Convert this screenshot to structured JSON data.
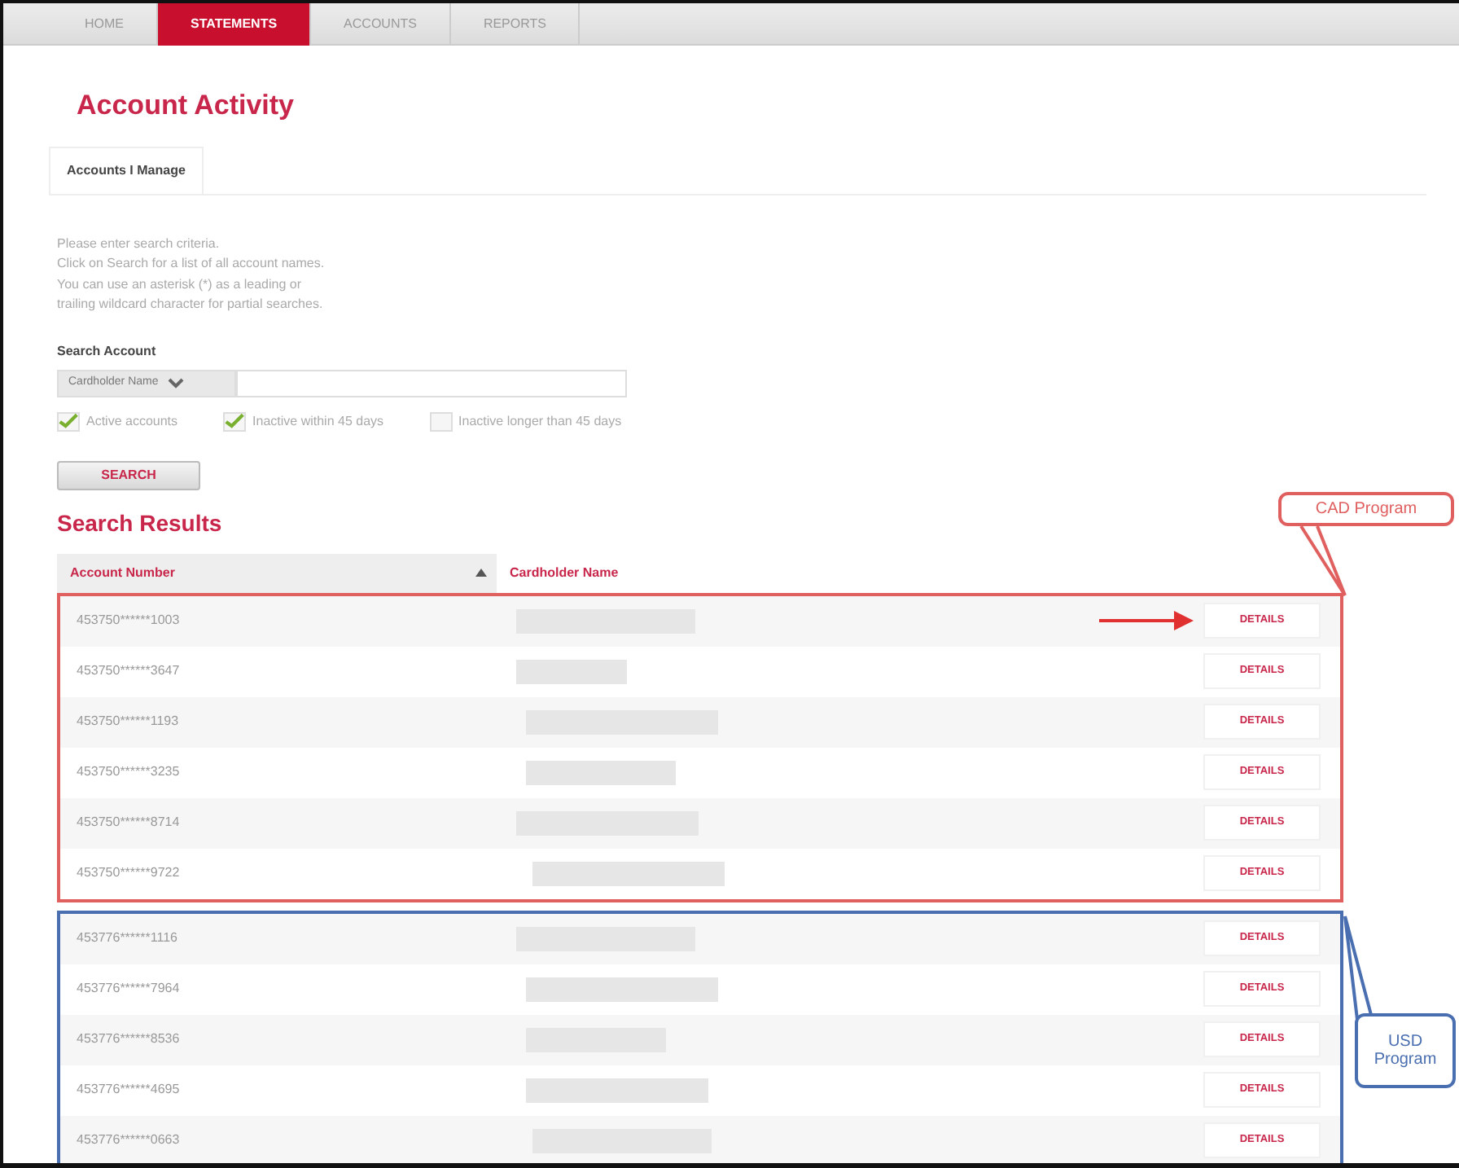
{
  "nav_tabs": [
    {
      "label": "HOME",
      "selected": false
    },
    {
      "label": "STATEMENTS",
      "selected": true
    },
    {
      "label": "ACCOUNTS",
      "selected": false
    },
    {
      "label": "REPORTS",
      "selected": false
    }
  ],
  "page_title": "Account Activity",
  "sub_tabs": [
    {
      "label": "Accounts I Manage",
      "selected": true
    }
  ],
  "instructions": [
    "Please enter search criteria.",
    "Click on Search for a list of all account names.",
    "You can use an asterisk (*) as a leading or",
    "trailing wildcard character for partial searches."
  ],
  "search": {
    "label": "Search Account",
    "field_type": "Cardholder Name"
  },
  "filters": [
    {
      "label": "Active accounts",
      "checked": true
    },
    {
      "label": "Inactive within 45 days",
      "checked": true
    },
    {
      "label": "Inactive longer than 45 days",
      "checked": false
    }
  ],
  "search_button": "SEARCH",
  "results_title": "Search Results",
  "columns": [
    {
      "label": "Account Number",
      "sorted": true
    },
    {
      "label": "Cardholder Name",
      "sorted": false
    }
  ],
  "groups": [
    {
      "label": "CAD Program",
      "color": "#e06060",
      "rows": [
        {
          "account": "453750******1003",
          "details": "DETAILS",
          "arrow": true
        },
        {
          "account": "453750******3647",
          "details": "DETAILS",
          "arrow": false
        },
        {
          "account": "453750******1193",
          "details": "DETAILS",
          "arrow": false
        },
        {
          "account": "453750******3235",
          "details": "DETAILS",
          "arrow": false
        },
        {
          "account": "453750******8714",
          "details": "DETAILS",
          "arrow": false
        },
        {
          "account": "453750******9722",
          "details": "DETAILS",
          "arrow": false
        }
      ]
    },
    {
      "label": "USD Program",
      "color": "#4a6fb0",
      "rows": [
        {
          "account": "453776******1116",
          "details": "DETAILS",
          "arrow": false
        },
        {
          "account": "453776******7964",
          "details": "DETAILS",
          "arrow": false
        },
        {
          "account": "453776******8536",
          "details": "DETAILS",
          "arrow": false
        },
        {
          "account": "453776******4695",
          "details": "DETAILS",
          "arrow": false
        },
        {
          "account": "453776******0663",
          "details": "DETAILS",
          "arrow": false
        }
      ]
    }
  ]
}
